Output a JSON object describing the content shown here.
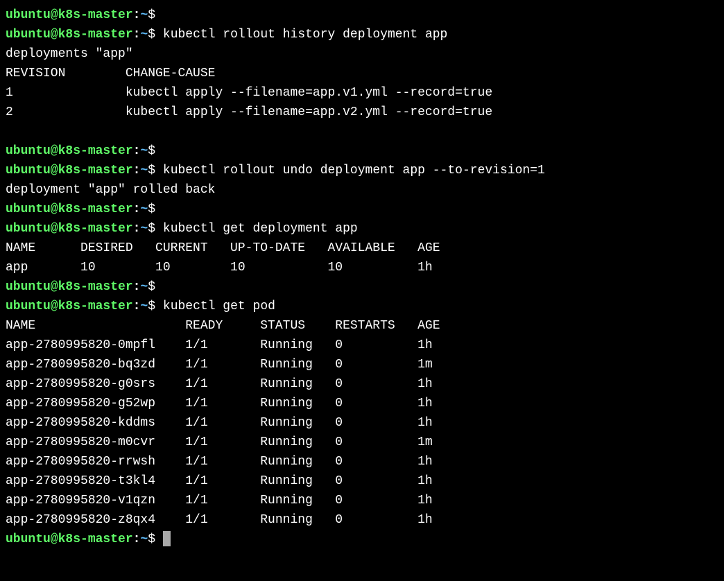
{
  "prompt": {
    "user_host": "ubuntu@k8s-master",
    "colon": ":",
    "path": "~",
    "dollar": "$"
  },
  "commands": {
    "c1": "kubectl rollout history deployment app",
    "c2": "kubectl rollout undo deployment app --to-revision=1",
    "c3": "kubectl get deployment app",
    "c4": "kubectl get pod"
  },
  "history": {
    "header": "deployments \"app\"",
    "col_header": "REVISION        CHANGE-CAUSE",
    "row1": "1               kubectl apply --filename=app.v1.yml --record=true",
    "row2": "2               kubectl apply --filename=app.v2.yml --record=true"
  },
  "undo": {
    "result": "deployment \"app\" rolled back"
  },
  "deployment": {
    "header": "NAME      DESIRED   CURRENT   UP-TO-DATE   AVAILABLE   AGE",
    "row": "app       10        10        10           10          1h"
  },
  "pods": {
    "header": "NAME                    READY     STATUS    RESTARTS   AGE",
    "rows": [
      "app-2780995820-0mpfl    1/1       Running   0          1h",
      "app-2780995820-bq3zd    1/1       Running   0          1m",
      "app-2780995820-g0srs    1/1       Running   0          1h",
      "app-2780995820-g52wp    1/1       Running   0          1h",
      "app-2780995820-kddms    1/1       Running   0          1h",
      "app-2780995820-m0cvr    1/1       Running   0          1m",
      "app-2780995820-rrwsh    1/1       Running   0          1h",
      "app-2780995820-t3kl4    1/1       Running   0          1h",
      "app-2780995820-v1qzn    1/1       Running   0          1h",
      "app-2780995820-z8qx4    1/1       Running   0          1h"
    ]
  }
}
